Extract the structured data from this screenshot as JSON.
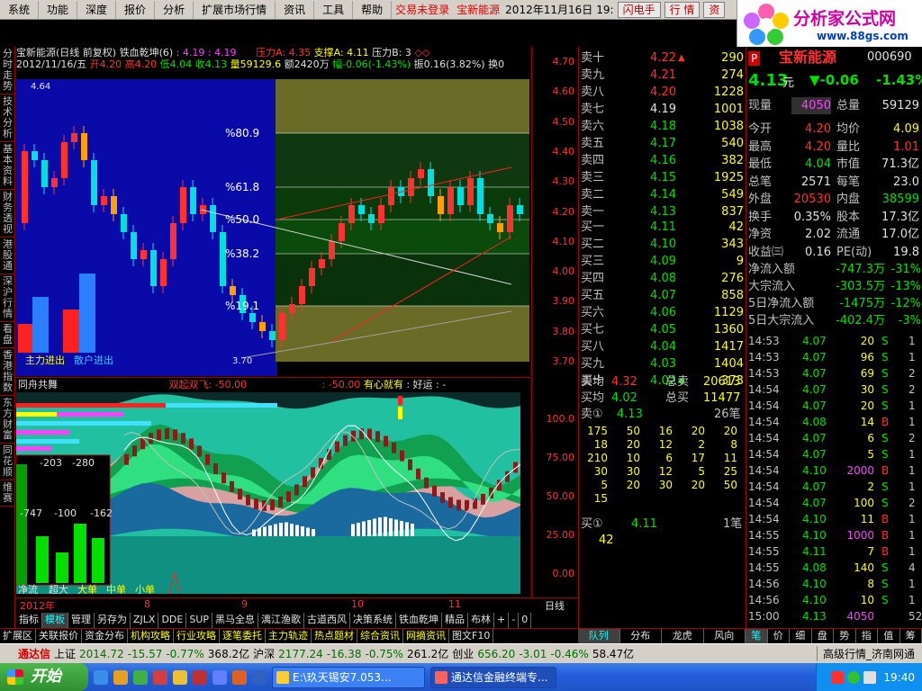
{
  "menu": {
    "items": [
      "系统",
      "功能",
      "深度",
      "报价",
      "分析",
      "扩展市场行情",
      "资讯",
      "工具",
      "帮助"
    ],
    "status_login": "交易未登录",
    "stock_name": "宝新能源",
    "date": "2012年11月16日",
    "time": "19:",
    "buttons": [
      "闪电手",
      "行 情",
      "资"
    ]
  },
  "logo": {
    "main": "分析家公式网",
    "url": "www.88gs.com"
  },
  "lefttabs": [
    "分时走势",
    "技术分析",
    "基本资料",
    "财务透视",
    "港股通",
    "深沪行情",
    "看盘",
    "香港指数",
    "东方财富",
    "同花顺",
    "维赛"
  ],
  "kline": {
    "title": "宝新能源(日线 前复权) 铁血乾坤(6)",
    "vals": ": 4.19 : 4.19",
    "pressure": "压力A: 4.35",
    "support": "支撑A: 4.11",
    "pressureB": "压力B: 3",
    "date_line": "2012/11/16/五",
    "open": "开4.20",
    "high": "高4.20",
    "low": "低4.04",
    "close": "收4.13",
    "volume": "量59129.6",
    "amount": "额2420万",
    "change": "幅-0.06(-1.43%)",
    "amplitude": "振0.16(3.82%)",
    "turnover": "换0",
    "top_price": "4.64",
    "bottom_price": "3.70",
    "fib_labels": [
      "%80.9",
      "%61.8",
      "%50.0",
      "%38.2",
      "%19.1"
    ],
    "legend_main": "主力进出",
    "legend_retail": "散户进出"
  },
  "yaxis1": [
    "4.70",
    "4.60",
    "4.50",
    "4.40",
    "4.30",
    "4.20",
    "4.10",
    "4.00",
    "3.90",
    "3.80",
    "3.70"
  ],
  "indicator": {
    "title": "同舟共舞",
    "signal": "双起双飞: -50.00",
    "v2": ": -50.00",
    "v3": "有心就有",
    "v4": ": 好运",
    "v5": ": -",
    "box_values": [
      "-203",
      "-280",
      "-747",
      "-100",
      "-162"
    ],
    "box_legend": [
      "净流",
      "超大",
      "大单",
      "中单",
      "小单"
    ]
  },
  "yaxis2": [
    "100.0",
    "75.00",
    "50.00",
    "25.00",
    "0.00"
  ],
  "xaxis": [
    "2012年",
    "8",
    "9",
    "10",
    "11"
  ],
  "day_label": "日线",
  "tabs1": [
    "指标",
    "模板",
    "管理",
    "另存为",
    "ZJLX",
    "DDE",
    "SUP",
    "黑马全息",
    "漓江渔歌",
    "古道西风",
    "决策系统",
    "铁血乾坤",
    "精品",
    "布林",
    "+",
    "-",
    "0"
  ],
  "tabs2": [
    "扩展区",
    "关联报价",
    "资金分布",
    "机构攻略",
    "行业攻略",
    "逐笔委托",
    "主力轨迹",
    "热点题材",
    "综合资讯",
    "网摘资讯",
    "图文F10"
  ],
  "book": {
    "asks": [
      {
        "label": "卖十",
        "price": "4.22",
        "vol": "290",
        "flag": "▲"
      },
      {
        "label": "卖九",
        "price": "4.21",
        "vol": "274",
        "flag": ""
      },
      {
        "label": "卖八",
        "price": "4.20",
        "vol": "1228",
        "flag": ""
      },
      {
        "label": "卖七",
        "price": "4.19",
        "vol": "1001",
        "flag": ""
      },
      {
        "label": "卖六",
        "price": "4.18",
        "vol": "1038",
        "flag": ""
      },
      {
        "label": "卖五",
        "price": "4.17",
        "vol": "540",
        "flag": ""
      },
      {
        "label": "卖四",
        "price": "4.16",
        "vol": "382",
        "flag": ""
      },
      {
        "label": "卖三",
        "price": "4.15",
        "vol": "1925",
        "flag": ""
      },
      {
        "label": "卖二",
        "price": "4.14",
        "vol": "549",
        "flag": ""
      },
      {
        "label": "卖一",
        "price": "4.13",
        "vol": "837",
        "flag": ""
      }
    ],
    "bids": [
      {
        "label": "买一",
        "price": "4.11",
        "vol": "42",
        "flag": ""
      },
      {
        "label": "买二",
        "price": "4.10",
        "vol": "343",
        "flag": ""
      },
      {
        "label": "买三",
        "price": "4.09",
        "vol": "9",
        "flag": ""
      },
      {
        "label": "买四",
        "price": "4.08",
        "vol": "276",
        "flag": ""
      },
      {
        "label": "买五",
        "price": "4.07",
        "vol": "858",
        "flag": ""
      },
      {
        "label": "买六",
        "price": "4.06",
        "vol": "1129",
        "flag": ""
      },
      {
        "label": "买七",
        "price": "4.05",
        "vol": "1360",
        "flag": ""
      },
      {
        "label": "买八",
        "price": "4.04",
        "vol": "1417",
        "flag": ""
      },
      {
        "label": "买九",
        "price": "4.03",
        "vol": "1404",
        "flag": ""
      },
      {
        "label": "买十",
        "price": "4.02",
        "vol": "373",
        "flag": "◆"
      }
    ],
    "avg_sell_label": "卖均",
    "avg_sell": "4.32",
    "total_sell_label": "总卖",
    "total_sell": "20613",
    "avg_buy_label": "买均",
    "avg_buy": "4.02",
    "total_buy_label": "总买",
    "total_buy": "11477",
    "sell1_queue_label": "卖①",
    "sell1_queue_price": "4.13",
    "sell1_queue_count": "26笔",
    "sell1_queue": [
      [
        "175",
        "50",
        "16",
        "20",
        "20"
      ],
      [
        "18",
        "20",
        "12",
        "2",
        "8"
      ],
      [
        "210",
        "10",
        "6",
        "17",
        "11"
      ],
      [
        "30",
        "30",
        "12",
        "5",
        "25"
      ],
      [
        "5",
        "20",
        "30",
        "20",
        "50"
      ],
      [
        "15",
        "",
        "",
        "",
        ""
      ]
    ],
    "buy1_queue_label": "买①",
    "buy1_queue_price": "4.11",
    "buy1_queue_count": "1笔",
    "buy1_queue": [
      "42"
    ],
    "tabs": [
      "队列",
      "分布",
      "龙虎",
      "风向"
    ]
  },
  "quote": {
    "p_badge": "P",
    "name": "宝新能源",
    "code": "000690",
    "price": "4.13",
    "price_unit": "元",
    "change": "▼-0.06",
    "change_pct": "-1.43%",
    "rows": [
      {
        "l1": "现量",
        "v1": "4050",
        "l2": "总量",
        "v2": "59129"
      },
      {
        "l1": "今开",
        "v1": "4.20",
        "l2": "均价",
        "v2": "4.09"
      },
      {
        "l1": "最高",
        "v1": "4.20",
        "l2": "量比",
        "v2": "1.01"
      },
      {
        "l1": "最低",
        "v1": "4.04",
        "l2": "市值",
        "v2": "71.3亿"
      },
      {
        "l1": "总笔",
        "v1": "2571",
        "l2": "每笔",
        "v2": "23.0"
      },
      {
        "l1": "外盘",
        "v1": "20530",
        "l2": "内盘",
        "v2": "38599"
      },
      {
        "l1": "换手",
        "v1": "0.35%",
        "l2": "股本",
        "v2": "17.3亿"
      },
      {
        "l1": "净资",
        "v1": "2.02",
        "l2": "流通",
        "v2": "17.0亿"
      },
      {
        "l1": "收益㈢",
        "v1": "0.16",
        "l2": "PE(动)",
        "v2": "19.8"
      }
    ],
    "flows": [
      {
        "l": "净流入额",
        "v": "-747.3万",
        "p": "-31%"
      },
      {
        "l": "大宗流入",
        "v": "-303.5万",
        "p": "-13%"
      },
      {
        "l": "5日净流入额",
        "v": "-1475万",
        "p": "-12%"
      },
      {
        "l": "5日大宗流入",
        "v": "-402.4万",
        "p": "-3%"
      }
    ],
    "ticks": [
      {
        "t": "14:53",
        "p": "4.07",
        "v": "20",
        "s": "S",
        "n": "1"
      },
      {
        "t": "14:53",
        "p": "4.07",
        "v": "96",
        "s": "S",
        "n": "1"
      },
      {
        "t": "14:53",
        "p": "4.07",
        "v": "69",
        "s": "S",
        "n": "2"
      },
      {
        "t": "14:54",
        "p": "4.07",
        "v": "30",
        "s": "S",
        "n": "2"
      },
      {
        "t": "14:54",
        "p": "4.07",
        "v": "20",
        "s": "S",
        "n": "1"
      },
      {
        "t": "14:54",
        "p": "4.08",
        "v": "14",
        "s": "B",
        "n": "1"
      },
      {
        "t": "14:54",
        "p": "4.07",
        "v": "6",
        "s": "S",
        "n": "2"
      },
      {
        "t": "14:54",
        "p": "4.07",
        "v": "5",
        "s": "S",
        "n": "1"
      },
      {
        "t": "14:54",
        "p": "4.10",
        "v": "2000",
        "s": "B",
        "n": "1"
      },
      {
        "t": "14:54",
        "p": "4.07",
        "v": "2",
        "s": "S",
        "n": "1"
      },
      {
        "t": "14:54",
        "p": "4.07",
        "v": "100",
        "s": "S",
        "n": "2"
      },
      {
        "t": "14:54",
        "p": "4.10",
        "v": "11",
        "s": "B",
        "n": "1"
      },
      {
        "t": "14:55",
        "p": "4.10",
        "v": "1000",
        "s": "B",
        "n": "1"
      },
      {
        "t": "14:55",
        "p": "4.11",
        "v": "7",
        "s": "B",
        "n": "1"
      },
      {
        "t": "14:55",
        "p": "4.08",
        "v": "140",
        "s": "S",
        "n": "4"
      },
      {
        "t": "14:56",
        "p": "4.10",
        "v": "8",
        "s": "S",
        "n": "1"
      },
      {
        "t": "14:56",
        "p": "4.10",
        "v": "10",
        "s": "S",
        "n": "1"
      },
      {
        "t": "15:00",
        "p": "4.13",
        "v": "4050",
        "s": "",
        "n": "52"
      }
    ],
    "tabs": [
      "笔",
      "价",
      "细",
      "盘",
      "势",
      "指",
      "值",
      "筹"
    ]
  },
  "indexbar": {
    "app": "通达信",
    "sh_label": "上证",
    "sh": "2014.72",
    "sh_chg": "-15.57",
    "sh_pct": "-0.77%",
    "sh_vol": "368.2亿",
    "hs_label": "沪深",
    "hs": "2177.24",
    "hs_chg": "-16.38",
    "hs_pct": "-0.75%",
    "hs_vol": "261.2亿",
    "cy_label": "创业",
    "cy": "656.20",
    "cy_chg": "-3.01",
    "cy_pct": "-0.46%",
    "cy_vol": "58.47亿",
    "right": "高级行情_济南网通"
  },
  "taskbar": {
    "start": "开始",
    "tasks": [
      "E:\\玖天锡安7.053...",
      "通达信金融终端专..."
    ],
    "clock": "19:40"
  },
  "colors": {
    "up": "#ff3030",
    "down": "#00e000",
    "vol": "#ffff00",
    "bg": "#000000",
    "grid": "#a00000"
  }
}
